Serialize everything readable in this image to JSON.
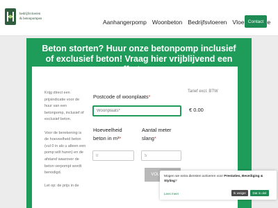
{
  "header": {
    "logo": {
      "line1": "bedrijfsvloeren",
      "line2": "& betonpompen"
    },
    "nav": [
      "Aanhangerpomp",
      "Woonbeton",
      "Bedrijfsvloeren",
      "Vloerrenovatie"
    ],
    "contact_label": "Contact"
  },
  "hero": {
    "title": "Beton storten? Huur onze betonpomp inclusief of exclusief beton! Vraag hier vrijblijvend een offerte op."
  },
  "form": {
    "intro_p1": "Krijg direct een prijsindicatie voor de huur van een betonpomp, inclusief of exclusief beton.",
    "intro_p2": "Voor de berekening is de hoeveelheid beton (vul 0 in als u alleen een pomp wilt huren) en de afstand waarover de beton verpompt wordt benodigd.",
    "intro_p3": "Let op: de prijs in de",
    "postcode_label": "Postcode of woonplaats",
    "postcode_placeholder": "Woonplaats*",
    "required_mark": "*",
    "hoeveelheid_label_1": "Hoeveelheid",
    "hoeveelheid_label_2": "beton in m³",
    "hoeveelheid_value": "0",
    "aantal_label_1": "Aantal meter",
    "aantal_label_2": "slang",
    "aantal_value": "5",
    "tarief_label": "Tarief excl. BTW",
    "price": "€ 0.00",
    "submit_label": "VOLGENDE"
  },
  "cookie": {
    "text_before": "Mogen we extra diensten activeren voor ",
    "text_bold": "Prestaties, Beveiliging & Styling",
    "text_after": "?",
    "link_label": "Lees meer",
    "decline_label": "Ik weiger",
    "accept_label": "Dat is oké"
  },
  "colors": {
    "brand_green": "#1f9c5a",
    "contact_green": "#1e8a54",
    "required_red": "#d23b3b"
  }
}
